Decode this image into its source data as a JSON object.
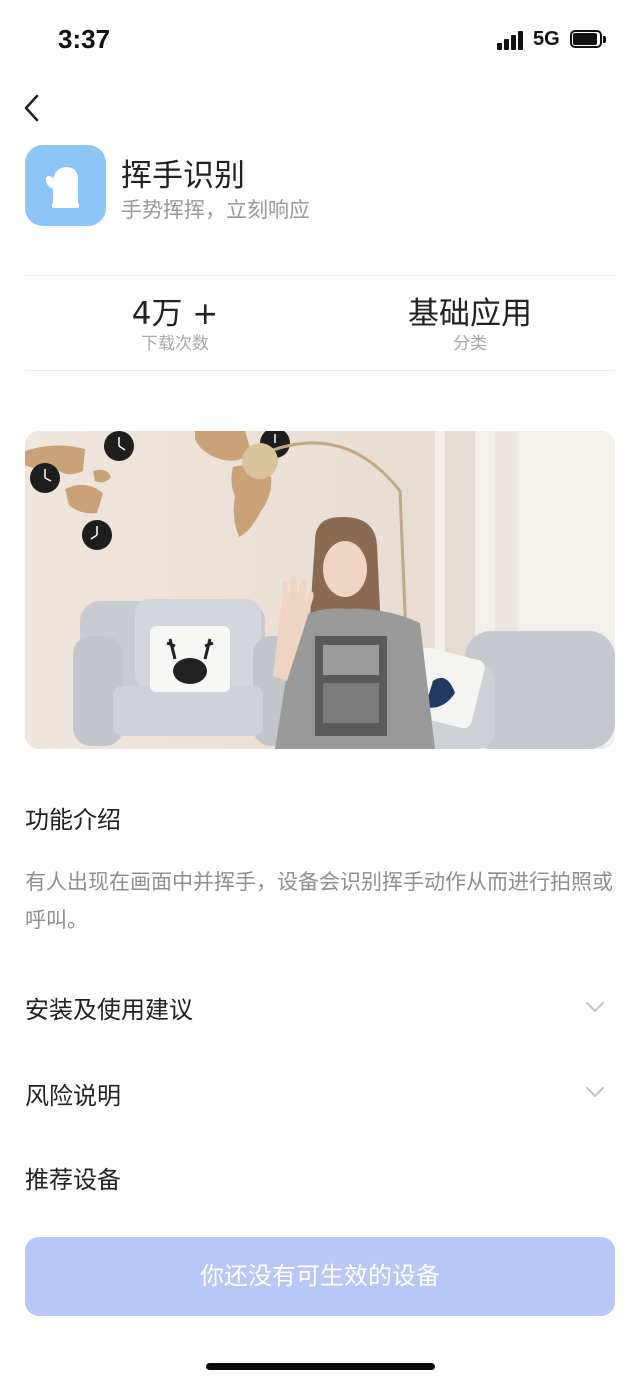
{
  "status_bar": {
    "time": "3:37",
    "network": "5G"
  },
  "app": {
    "title": "挥手识别",
    "subtitle": "手势挥挥，立刻响应",
    "icon": "glove-icon",
    "accent_color": "#8cc5f6"
  },
  "stats": [
    {
      "value": "4万 +",
      "label": "下载次数"
    },
    {
      "value": "基础应用",
      "label": "分类"
    }
  ],
  "hero_image": {
    "description_icon": "photo-woman-waving"
  },
  "intro": {
    "title": "功能介绍",
    "text": "有人出现在画面中并挥手，设备会识别挥手动作从而进行拍照或呼叫。"
  },
  "sections": [
    {
      "title": "安装及使用建议",
      "icon": "chevron-down-icon"
    },
    {
      "title": "风险说明",
      "icon": "chevron-down-icon"
    },
    {
      "title": "推荐设备"
    }
  ],
  "cta": {
    "label": "你还没有可生效的设备",
    "color": "#b8c7f5"
  }
}
